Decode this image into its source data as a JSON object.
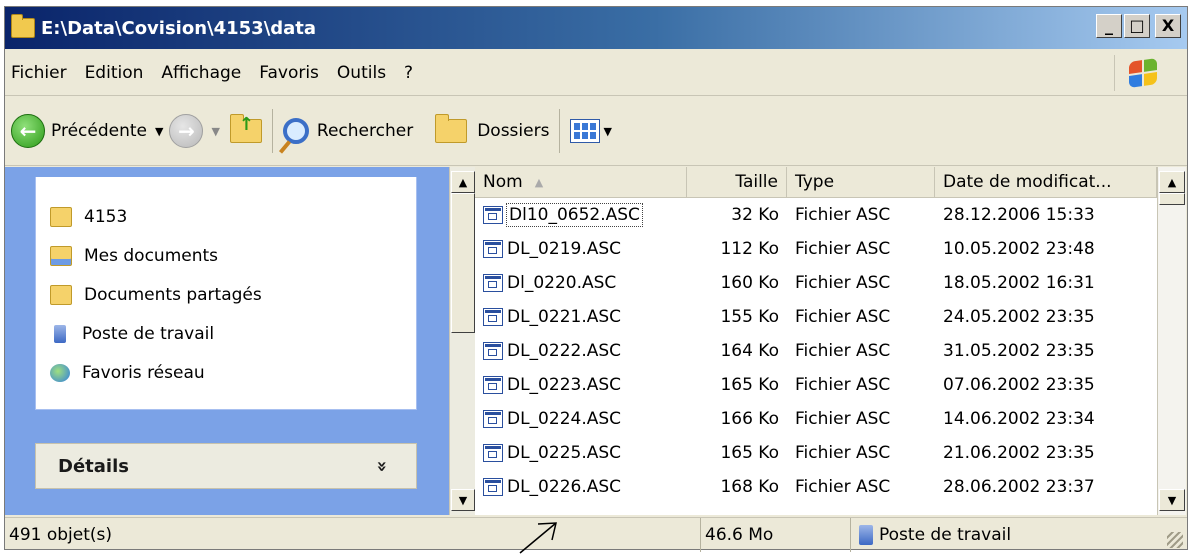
{
  "window": {
    "title": "E:\\Data\\Covision\\4153\\data",
    "buttons": {
      "minimize": "_",
      "maximize": "□",
      "close": "X"
    }
  },
  "menu": {
    "items": [
      "Fichier",
      "Edition",
      "Affichage",
      "Favoris",
      "Outils",
      "?"
    ]
  },
  "toolbar": {
    "back_label": "Précédente",
    "search_label": "Rechercher",
    "folders_label": "Dossiers"
  },
  "sidebar": {
    "places": [
      {
        "label": "4153",
        "icon": "folder-icon"
      },
      {
        "label": "Mes documents",
        "icon": "my-documents-icon"
      },
      {
        "label": "Documents partagés",
        "icon": "folder-icon"
      },
      {
        "label": "Poste de travail",
        "icon": "computer-icon"
      },
      {
        "label": "Favoris réseau",
        "icon": "network-icon"
      }
    ],
    "details_label": "Détails",
    "details_chevron": "»"
  },
  "filelist": {
    "columns": {
      "name": "Nom",
      "size": "Taille",
      "type": "Type",
      "date": "Date de modificat..."
    },
    "sort_indicator": "▲",
    "rows": [
      {
        "name": "Dl10_0652.ASC",
        "size": "32 Ko",
        "type": "Fichier ASC",
        "date": "28.12.2006 15:33"
      },
      {
        "name": "DL_0219.ASC",
        "size": "112 Ko",
        "type": "Fichier ASC",
        "date": "10.05.2002 23:48"
      },
      {
        "name": "Dl_0220.ASC",
        "size": "160 Ko",
        "type": "Fichier ASC",
        "date": "18.05.2002 16:31"
      },
      {
        "name": "DL_0221.ASC",
        "size": "155 Ko",
        "type": "Fichier ASC",
        "date": "24.05.2002 23:35"
      },
      {
        "name": "DL_0222.ASC",
        "size": "164 Ko",
        "type": "Fichier ASC",
        "date": "31.05.2002 23:35"
      },
      {
        "name": "DL_0223.ASC",
        "size": "165 Ko",
        "type": "Fichier ASC",
        "date": "07.06.2002 23:35"
      },
      {
        "name": "DL_0224.ASC",
        "size": "166 Ko",
        "type": "Fichier ASC",
        "date": "14.06.2002 23:34"
      },
      {
        "name": "DL_0225.ASC",
        "size": "165 Ko",
        "type": "Fichier ASC",
        "date": "21.06.2002 23:35"
      },
      {
        "name": "DL_0226.ASC",
        "size": "168 Ko",
        "type": "Fichier ASC",
        "date": "28.06.2002 23:37"
      }
    ]
  },
  "statusbar": {
    "count": "491 objet(s)",
    "size": "46.6 Mo",
    "location": "Poste de travail"
  },
  "colors": {
    "titlebar_start": "#0a246a",
    "sidebar_bg": "#7ba2e7",
    "window_bg": "#ece9d8"
  }
}
